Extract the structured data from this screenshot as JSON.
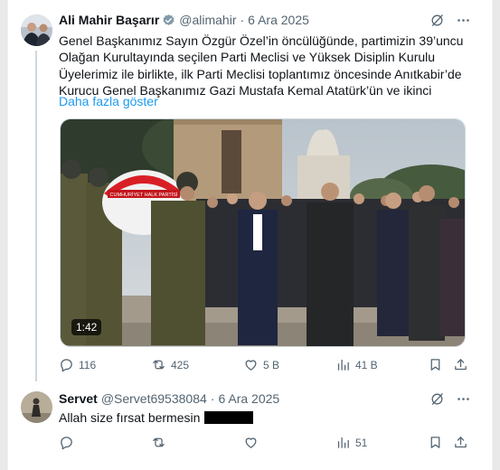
{
  "tweet1": {
    "name": "Ali Mahir Başarır",
    "handle": "@alimahir",
    "separator": "·",
    "date": "6 Ara 2025",
    "text_lines": [
      "Genel Başkanımız Sayın Özgür Özel’in öncülüğünde, partimizin 39’uncu",
      "Olağan Kurultayında seçilen Parti Meclisi ve Yüksek Disiplin Kurulu",
      "Üyelerimiz ile birlikte, ilk Parti Meclisi toplantımız öncesinde Anıtkabir’de",
      "Kurucu Genel Başkanımız Gazi Mustafa Kemal Atatürk’ün ve ikinci"
    ],
    "show_more": "Daha fazla göster",
    "video_duration": "1:42",
    "wreath_text": "CUMHURİYET HALK PARTİSİ",
    "actions": {
      "replies": "116",
      "reposts": "425",
      "likes": "5 B",
      "views": "41 B"
    }
  },
  "tweet2": {
    "name": "Servet",
    "handle": "@Servet69538084",
    "separator": "·",
    "date": "6 Ara 2025",
    "text": "Allah size fırsat bermesin",
    "actions": {
      "views": "51"
    }
  },
  "colors": {
    "text_primary": "#0f1419",
    "text_secondary": "#536471",
    "link": "#1d9bf0",
    "verified": "#829aab",
    "border": "#cfd9de"
  },
  "icons": [
    "grok-icon",
    "more-icon",
    "reply-icon",
    "repost-icon",
    "like-icon",
    "views-icon",
    "bookmark-icon",
    "share-icon",
    "verified-badge-icon"
  ]
}
